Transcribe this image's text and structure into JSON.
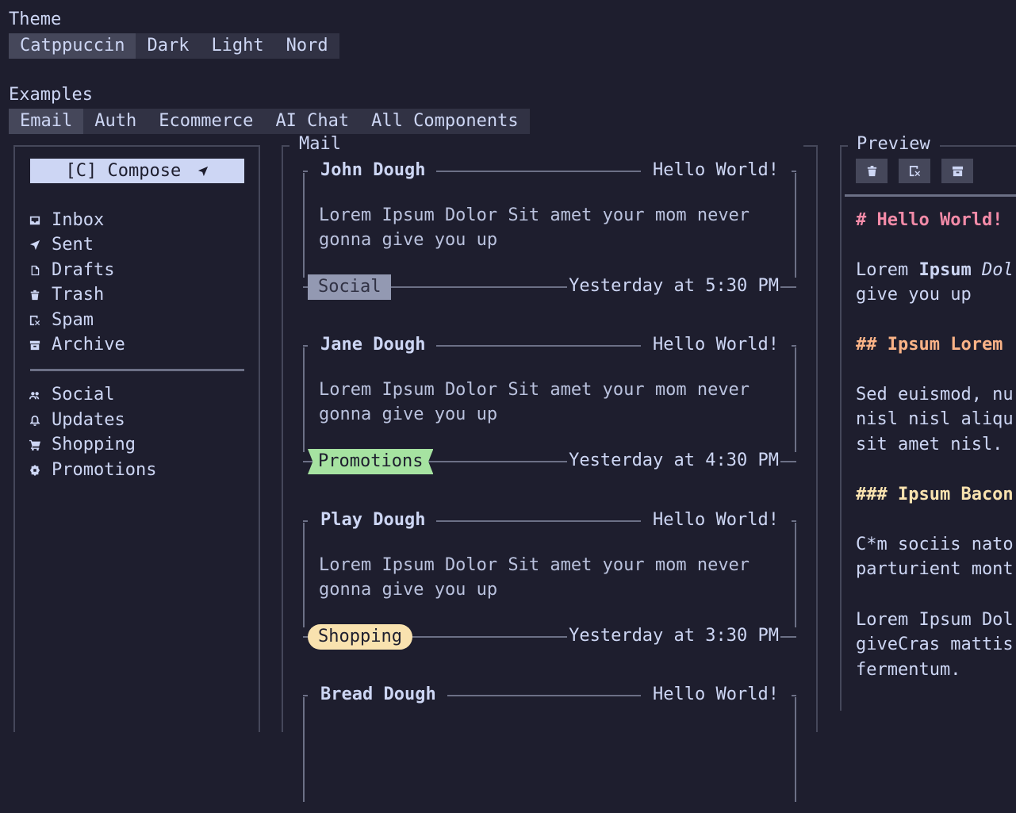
{
  "theme": {
    "label": "Theme",
    "options": [
      "Catppuccin",
      "Dark",
      "Light",
      "Nord"
    ],
    "selected": "Catppuccin"
  },
  "examples": {
    "label": "Examples",
    "options": [
      "Email",
      "Auth",
      "Ecommerce",
      "AI Chat",
      "All Components"
    ],
    "selected": "Email"
  },
  "sidebar": {
    "compose_label": "[C] Compose",
    "folders": [
      {
        "label": "Inbox",
        "icon": "inbox-icon"
      },
      {
        "label": "Sent",
        "icon": "send-icon"
      },
      {
        "label": "Drafts",
        "icon": "file-icon"
      },
      {
        "label": "Trash",
        "icon": "trash-icon"
      },
      {
        "label": "Spam",
        "icon": "spam-icon"
      },
      {
        "label": "Archive",
        "icon": "archive-icon"
      }
    ],
    "categories": [
      {
        "label": "Social",
        "icon": "users-icon"
      },
      {
        "label": "Updates",
        "icon": "bell-icon"
      },
      {
        "label": "Shopping",
        "icon": "cart-icon"
      },
      {
        "label": "Promotions",
        "icon": "badge-icon"
      }
    ]
  },
  "mail": {
    "title": "Mail",
    "items": [
      {
        "sender": "John Dough",
        "subject": "Hello World!",
        "body": "Lorem Ipsum Dolor Sit amet your mom never gonna give you up",
        "tag": "Social",
        "date": "Yesterday at 5:30 PM"
      },
      {
        "sender": "Jane Dough",
        "subject": "Hello World!",
        "body": "Lorem Ipsum Dolor Sit amet your mom never gonna give you up",
        "tag": "Promotions",
        "date": "Yesterday at 4:30 PM"
      },
      {
        "sender": "Play Dough",
        "subject": "Hello World!",
        "body": "Lorem Ipsum Dolor Sit amet your mom never gonna give you up",
        "tag": "Shopping",
        "date": "Yesterday at 3:30 PM"
      },
      {
        "sender": "Bread Dough",
        "subject": "Hello World!"
      }
    ]
  },
  "preview": {
    "title": "Preview",
    "h1": "# Hello World!",
    "p1_a": "Lorem ",
    "p1_b": "Ipsum",
    "p1_c": " Dol",
    "p1_line2": "give you up",
    "h2": "## Ipsum Lorem",
    "p2": [
      "Sed euismod, nu",
      "nisl nisl aliqu",
      "sit amet nisl."
    ],
    "h3": "### Ipsum Bacon",
    "p3": [
      "C*m sociis nato",
      "parturient mont"
    ],
    "p4": [
      "Lorem Ipsum Dol",
      "giveCras mattis",
      "fermentum."
    ]
  },
  "colors": {
    "background": "#1e1e2e",
    "text": "#cdd6f4",
    "tag_social": "#9399b2",
    "tag_promotions": "#a6e3a1",
    "tag_shopping": "#f9e2af",
    "h1": "#f38ba8",
    "h2": "#fab387",
    "h3": "#f9e2af"
  }
}
